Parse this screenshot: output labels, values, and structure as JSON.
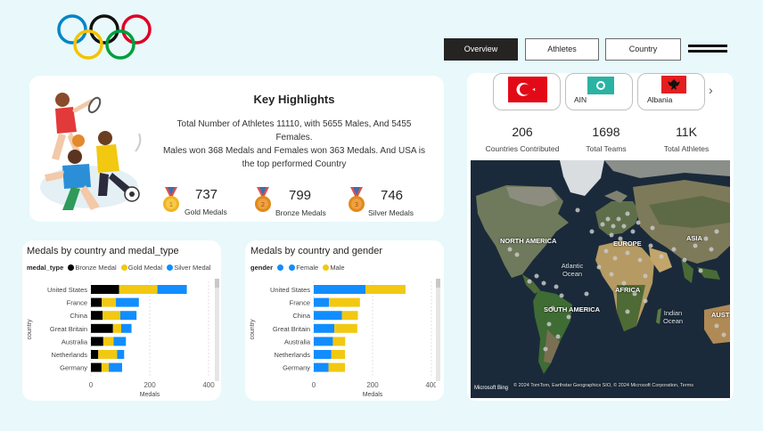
{
  "nav": {
    "tabs": [
      "Overview",
      "Athletes",
      "Country"
    ],
    "active": "Overview"
  },
  "highlights": {
    "title": "Key Highlights",
    "line1": "Total Number of Athletes 11110, with 5655 Males, And 5455 Females.",
    "line2": "Males won 368 Medals and Females won 363 Medals. And USA is the top performed Country",
    "medals": [
      {
        "value": "737",
        "label": "Gold Medals",
        "color": "#e8a317"
      },
      {
        "value": "799",
        "label": "Bronze Medals",
        "color": "#e08a1c"
      },
      {
        "value": "746",
        "label": "Silver Medals",
        "color": "#e08a1c"
      }
    ]
  },
  "countries": {
    "flags": [
      {
        "label": "",
        "icon": "turkey-flag-icon"
      },
      {
        "label": "AIN",
        "icon": "ain-flag-icon"
      },
      {
        "label": "Albania",
        "icon": "albania-flag-icon"
      }
    ],
    "kpis": [
      {
        "value": "206",
        "label": "Countries Contributed"
      },
      {
        "value": "1698",
        "label": "Total Teams"
      },
      {
        "value": "11K",
        "label": "Total Athletes"
      }
    ]
  },
  "map": {
    "continents": [
      "NORTH AMERICA",
      "EUROPE",
      "ASIA",
      "AFRICA",
      "SOUTH AMERICA",
      "AUST"
    ],
    "oceans": [
      "Atlantic Ocean",
      "Indian Ocean"
    ],
    "attribution": "© 2024 TomTom, Earthstar Geographics SIO, © 2024 Microsoft Corporation, Terms",
    "brand": "Microsoft Bing"
  },
  "chart_data": [
    {
      "type": "bar",
      "title": "Medals by country and medal_type",
      "legend_title": "medal_type",
      "xlabel": "Medals",
      "ylabel": "country",
      "xlim": [
        0,
        400
      ],
      "ticks": [
        "0",
        "200",
        "400"
      ],
      "categories": [
        "United States",
        "France",
        "China",
        "Great Britain",
        "Australia",
        "Netherlands",
        "Germany"
      ],
      "series": [
        {
          "name": "Bronze Medal",
          "color": "#000000",
          "values": [
            96,
            37,
            40,
            75,
            42,
            25,
            36
          ]
        },
        {
          "name": "Gold Medal",
          "color": "#f2c811",
          "values": [
            130,
            48,
            60,
            28,
            35,
            64,
            25
          ]
        },
        {
          "name": "Silver Medal",
          "color": "#118dff",
          "values": [
            100,
            78,
            55,
            35,
            42,
            24,
            45
          ]
        }
      ]
    },
    {
      "type": "bar",
      "title": "Medals by country and gender",
      "legend_title": "gender",
      "xlabel": "Medals",
      "ylabel": "country",
      "xlim": [
        0,
        400
      ],
      "ticks": [
        "0",
        "200",
        "400"
      ],
      "categories": [
        "United States",
        "France",
        "China",
        "Great Britain",
        "Australia",
        "Netherlands",
        "Germany"
      ],
      "series": [
        {
          "name": "",
          "color": "#118dff",
          "values": [
            0,
            0,
            0,
            0,
            0,
            0,
            0
          ]
        },
        {
          "name": "Female",
          "color": "#118dff",
          "values": [
            176,
            52,
            96,
            70,
            65,
            60,
            50
          ]
        },
        {
          "name": "Male",
          "color": "#f2c811",
          "values": [
            136,
            105,
            54,
            78,
            42,
            46,
            56
          ]
        }
      ]
    }
  ]
}
